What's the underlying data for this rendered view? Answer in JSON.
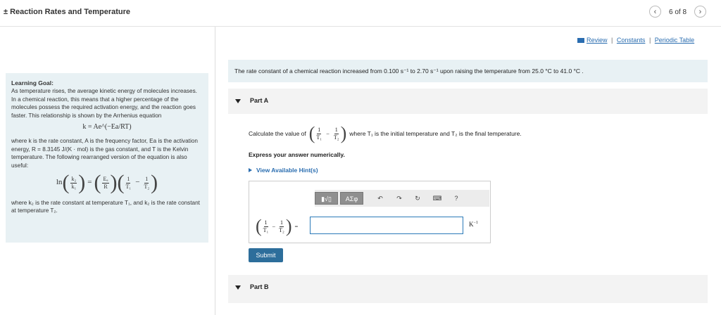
{
  "header": {
    "title": "± Reaction Rates and Temperature",
    "prev": "‹",
    "pager": "6 of 8",
    "next": "›"
  },
  "links": {
    "review": "Review",
    "constants": "Constants",
    "periodic_table": "Periodic Table",
    "separator": "|"
  },
  "goal": {
    "heading": "Learning Goal:",
    "p1": "As temperature rises, the average kinetic energy of molecules increases. In a chemical reaction, this means that a higher percentage of the molecules possess the required activation energy, and the reaction goes faster. This relationship is shown by the Arrhenius equation",
    "arrhenius": "k = Ae^(−Ea/RT)",
    "p2": "where k is the rate constant, A is the frequency factor, Ea is the activation energy, R = 8.3145 J/(K · mol) is the gas constant, and T is the Kelvin temperature. The following rearranged version of the equation is also useful:",
    "eq2": {
      "ln": "ln",
      "k2": "k₂",
      "k1": "k₁",
      "eq": "=",
      "ea": "Eₐ",
      "r": "R",
      "one": "1",
      "t1": "T₁",
      "minus": "−",
      "t2": "T₂"
    },
    "p3": "where k₂ is the rate constant at temperature T₁, and k₂ is the rate constant at temperature T₂."
  },
  "problem": "The rate constant of a chemical reaction increased from 0.100 s⁻¹ to 2.70 s⁻¹ upon raising the temperature from 25.0 °C to 41.0 °C .",
  "partA": {
    "label": "Part A",
    "calc_prefix": "Calculate the value of",
    "calc_suffix": "where T₁ is the initial temperature and T₂ is the final temperature.",
    "express": "Express your answer numerically.",
    "hint": "View Available Hint(s)",
    "toolbar": {
      "templates": "▮√▯",
      "symbols": "AΣφ",
      "undo": "↶",
      "redo": "↷",
      "reset": "↻",
      "keyboard": "⌨",
      "help": "?"
    },
    "answer_value": "",
    "unit": "K",
    "unit_exp": "−1",
    "submit": "Submit"
  },
  "partB": {
    "label": "Part B"
  },
  "colors": {
    "accent": "#2a6db0",
    "panel": "#e8f1f4",
    "submit": "#2d6e9b"
  }
}
